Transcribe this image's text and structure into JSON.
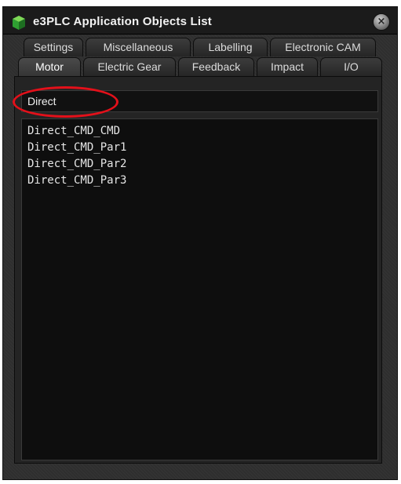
{
  "window": {
    "title": "e3PLC Application Objects List",
    "close_glyph": "×"
  },
  "tabs": {
    "back_row": [
      {
        "label": "Settings"
      },
      {
        "label": "Miscellaneous"
      },
      {
        "label": "Labelling"
      },
      {
        "label": "Electronic CAM"
      }
    ],
    "front_row": [
      {
        "label": "Motor",
        "active": true
      },
      {
        "label": "Electric Gear"
      },
      {
        "label": "Feedback"
      },
      {
        "label": "Impact"
      },
      {
        "label": "I/O"
      }
    ]
  },
  "search": {
    "value": "Direct"
  },
  "results": [
    "Direct_CMD_CMD",
    "Direct_CMD_Par1",
    "Direct_CMD_Par2",
    "Direct_CMD_Par3"
  ],
  "colors": {
    "highlight": "#e3101a",
    "icon_green": "#2fa032"
  },
  "icons": {
    "app": "green-cube-icon",
    "close": "close-icon"
  }
}
